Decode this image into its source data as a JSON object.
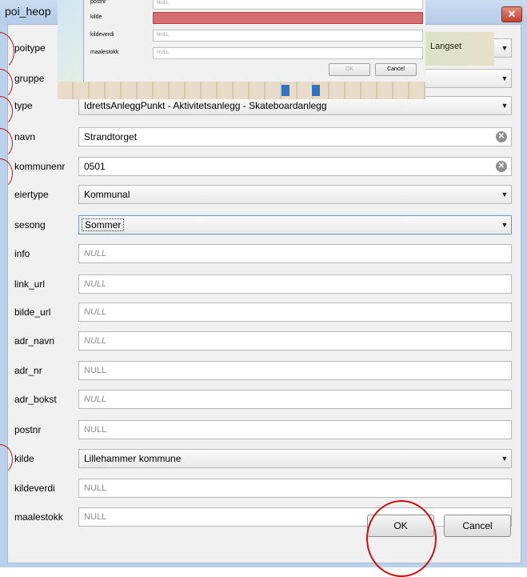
{
  "window": {
    "title": "poi_heop",
    "close_icon": "close-icon"
  },
  "fields": [
    {
      "id": "poitype",
      "label": "poitype",
      "kind": "combo",
      "value": ""
    },
    {
      "id": "gruppe",
      "label": "gruppe",
      "kind": "combo",
      "value": ""
    },
    {
      "id": "type",
      "label": "type",
      "kind": "combo",
      "value": "IdrettsAnleggPunkt - Aktivitetsanlegg - Skateboardanlegg"
    },
    {
      "id": "navn",
      "label": "navn",
      "kind": "text",
      "value": "Strandtorget"
    },
    {
      "id": "kommunenr",
      "label": "kommunenr",
      "kind": "text",
      "value": "0501"
    },
    {
      "id": "eiertype",
      "label": "eiertype",
      "kind": "combo",
      "value": "Kommunal"
    },
    {
      "id": "sesong",
      "label": "sesong",
      "kind": "combo",
      "value": "Sommer"
    },
    {
      "id": "info",
      "label": "info",
      "kind": "text",
      "value": "NULL"
    },
    {
      "id": "link_url",
      "label": "link_url",
      "kind": "text",
      "value": "NULL"
    },
    {
      "id": "bilde_url",
      "label": "bilde_url",
      "kind": "text",
      "value": "NULL"
    },
    {
      "id": "adr_navn",
      "label": "adr_navn",
      "kind": "text",
      "value": "NULL"
    },
    {
      "id": "adr_nr",
      "label": "adr_nr",
      "kind": "text",
      "value": "NULL"
    },
    {
      "id": "adr_bokst",
      "label": "adr_bokst",
      "kind": "text",
      "value": "NULL"
    },
    {
      "id": "postnr",
      "label": "postnr",
      "kind": "text",
      "value": "NULL"
    },
    {
      "id": "kilde",
      "label": "kilde",
      "kind": "combo",
      "value": "Lillehammer kommune"
    },
    {
      "id": "kildeverdi",
      "label": "kildeverdi",
      "kind": "text",
      "value": "NULL"
    },
    {
      "id": "maalestokk",
      "label": "maalestokk",
      "kind": "text",
      "value": "NULL"
    }
  ],
  "buttons": {
    "ok": "OK",
    "cancel": "Cancel"
  },
  "inset": {
    "rows": [
      {
        "label": "postnr",
        "value": "NULL"
      },
      {
        "label": "kilde",
        "value": ""
      },
      {
        "label": "kildeverdi",
        "value": "NULL"
      },
      {
        "label": "maalestokk",
        "value": "NULL"
      }
    ],
    "ok": "OK",
    "cancel": "Cancel",
    "map_text": "Langset"
  },
  "colors": {
    "annotation": "#cc1111",
    "error_field": "#d66e6e",
    "focus": "#6c96c8"
  }
}
